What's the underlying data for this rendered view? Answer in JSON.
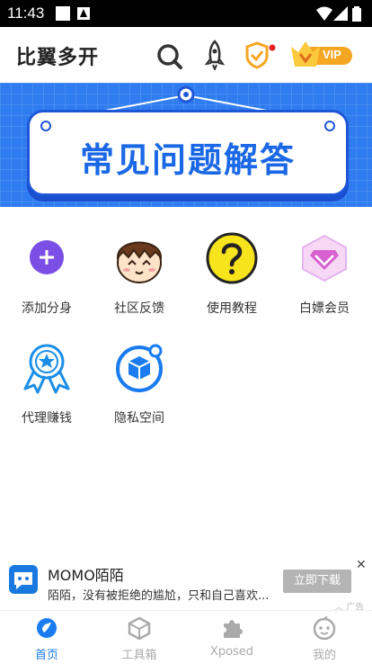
{
  "status_bar": {
    "time": "11:43"
  },
  "header": {
    "title": "比翼多开",
    "vip_label": "VIP"
  },
  "banner": {
    "text": "常见问题解答"
  },
  "features": [
    {
      "label": "添加分身",
      "icon": "add-circle-icon"
    },
    {
      "label": "社区反馈",
      "icon": "cartoon-face-icon"
    },
    {
      "label": "使用教程",
      "icon": "question-icon"
    },
    {
      "label": "白嫖会员",
      "icon": "diamond-icon"
    },
    {
      "label": "代理赚钱",
      "icon": "award-ribbon-icon"
    },
    {
      "label": "隐私空间",
      "icon": "privacy-box-icon"
    }
  ],
  "ad": {
    "title": "MOMO陌陌",
    "description": "陌陌，没有被拒绝的尴尬，只和自己喜欢...",
    "button": "立即下载",
    "tag": "广告"
  },
  "tabs": [
    {
      "label": "首页",
      "icon": "home-icon",
      "active": true
    },
    {
      "label": "工具箱",
      "icon": "toolbox-cube-icon",
      "active": false
    },
    {
      "label": "Xposed",
      "icon": "puzzle-icon",
      "active": false
    },
    {
      "label": "我的",
      "icon": "profile-icon",
      "active": false
    }
  ],
  "colors": {
    "accent": "#1a7cf0",
    "banner_bg": "#2f7cf0",
    "tab_inactive": "#aaaaaa",
    "vip_orange": "#f5a623"
  }
}
